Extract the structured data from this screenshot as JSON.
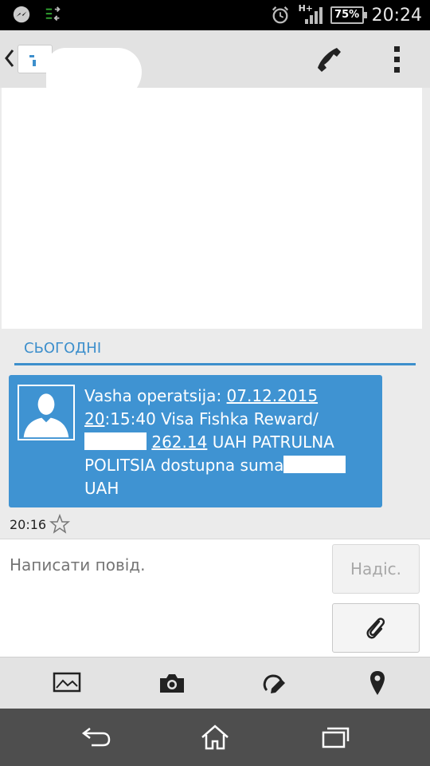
{
  "status_bar": {
    "battery_level": "75%",
    "network_type": "H+",
    "time": "20:24",
    "icons": [
      "messenger-icon",
      "data-sync-icon",
      "alarm-icon",
      "signal-icon",
      "battery-icon"
    ]
  },
  "action_bar": {
    "icons": [
      "back-chevron-icon",
      "phone-icon",
      "overflow-menu-icon"
    ]
  },
  "conversation": {
    "date_header": "СЬОГОДНІ",
    "message": {
      "part1": "Vasha operatsija: ",
      "date_link": "07.12.2015",
      "time_link": "20",
      "part2": ":15:40 Visa Fishka Reward/",
      "amount_link": "262.14",
      "part3": " UAH PATRULNA POLITSIA dostupna suma",
      "part4": " UAH",
      "time": "20:16"
    }
  },
  "composer": {
    "placeholder": "Написати повід.",
    "send_label": "Надіс."
  },
  "toolbar": {
    "icons": [
      "picture-icon",
      "camera-icon",
      "sketch-icon",
      "location-icon"
    ]
  },
  "nav_bar": {
    "icons": [
      "back-icon",
      "home-icon",
      "recents-icon"
    ]
  },
  "colors": {
    "accent": "#3d8fcc",
    "bubble": "#3f93d2",
    "nav_bar": "#4e4e4e"
  }
}
